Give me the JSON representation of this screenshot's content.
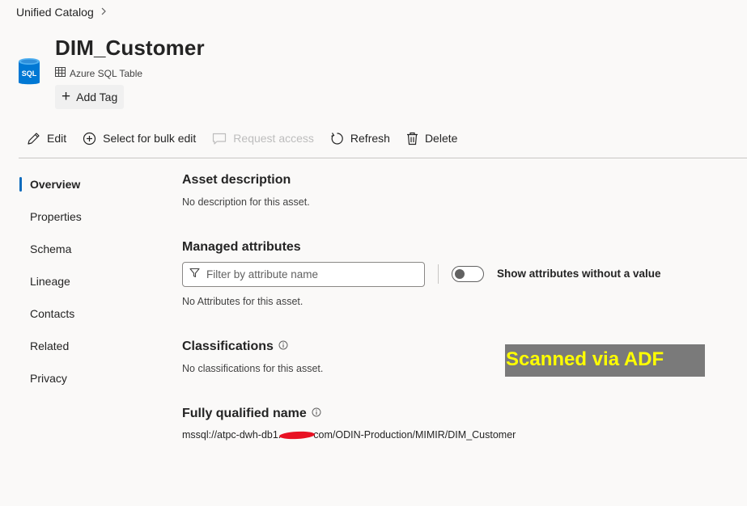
{
  "breadcrumb": {
    "root": "Unified Catalog",
    "chevron_icon": "chevron-right-icon"
  },
  "asset": {
    "icon_label": "SQL",
    "title": "DIM_Customer",
    "type": "Azure SQL Table",
    "add_tag_label": "Add Tag"
  },
  "toolbar": {
    "edit": "Edit",
    "bulk_edit": "Select for bulk edit",
    "request_access": "Request access",
    "refresh": "Refresh",
    "delete": "Delete"
  },
  "nav": {
    "items": [
      {
        "label": "Overview",
        "active": true
      },
      {
        "label": "Properties"
      },
      {
        "label": "Schema"
      },
      {
        "label": "Lineage"
      },
      {
        "label": "Contacts"
      },
      {
        "label": "Related"
      },
      {
        "label": "Privacy"
      }
    ]
  },
  "overview": {
    "description": {
      "title": "Asset description",
      "text": "No description for this asset."
    },
    "managed_attributes": {
      "title": "Managed attributes",
      "filter_placeholder": "Filter by attribute name",
      "toggle_label": "Show attributes without a value",
      "toggle_on": false,
      "empty_text": "No Attributes for this asset."
    },
    "classifications": {
      "title": "Classifications",
      "text": "No classifications for this asset."
    },
    "fqn": {
      "title": "Fully qualified name",
      "prefix": "mssql://atpc-dwh-db1.",
      "suffix": "com/ODIN-Production/MIMIR/DIM_Customer"
    }
  },
  "annotation": {
    "text": "Scanned via ADF",
    "bg_color": "#7a7a7a",
    "text_color": "#ffff00"
  },
  "colors": {
    "accent": "#0f6cbd",
    "sql_icon": "#0078d4",
    "redaction": "#e81123"
  }
}
